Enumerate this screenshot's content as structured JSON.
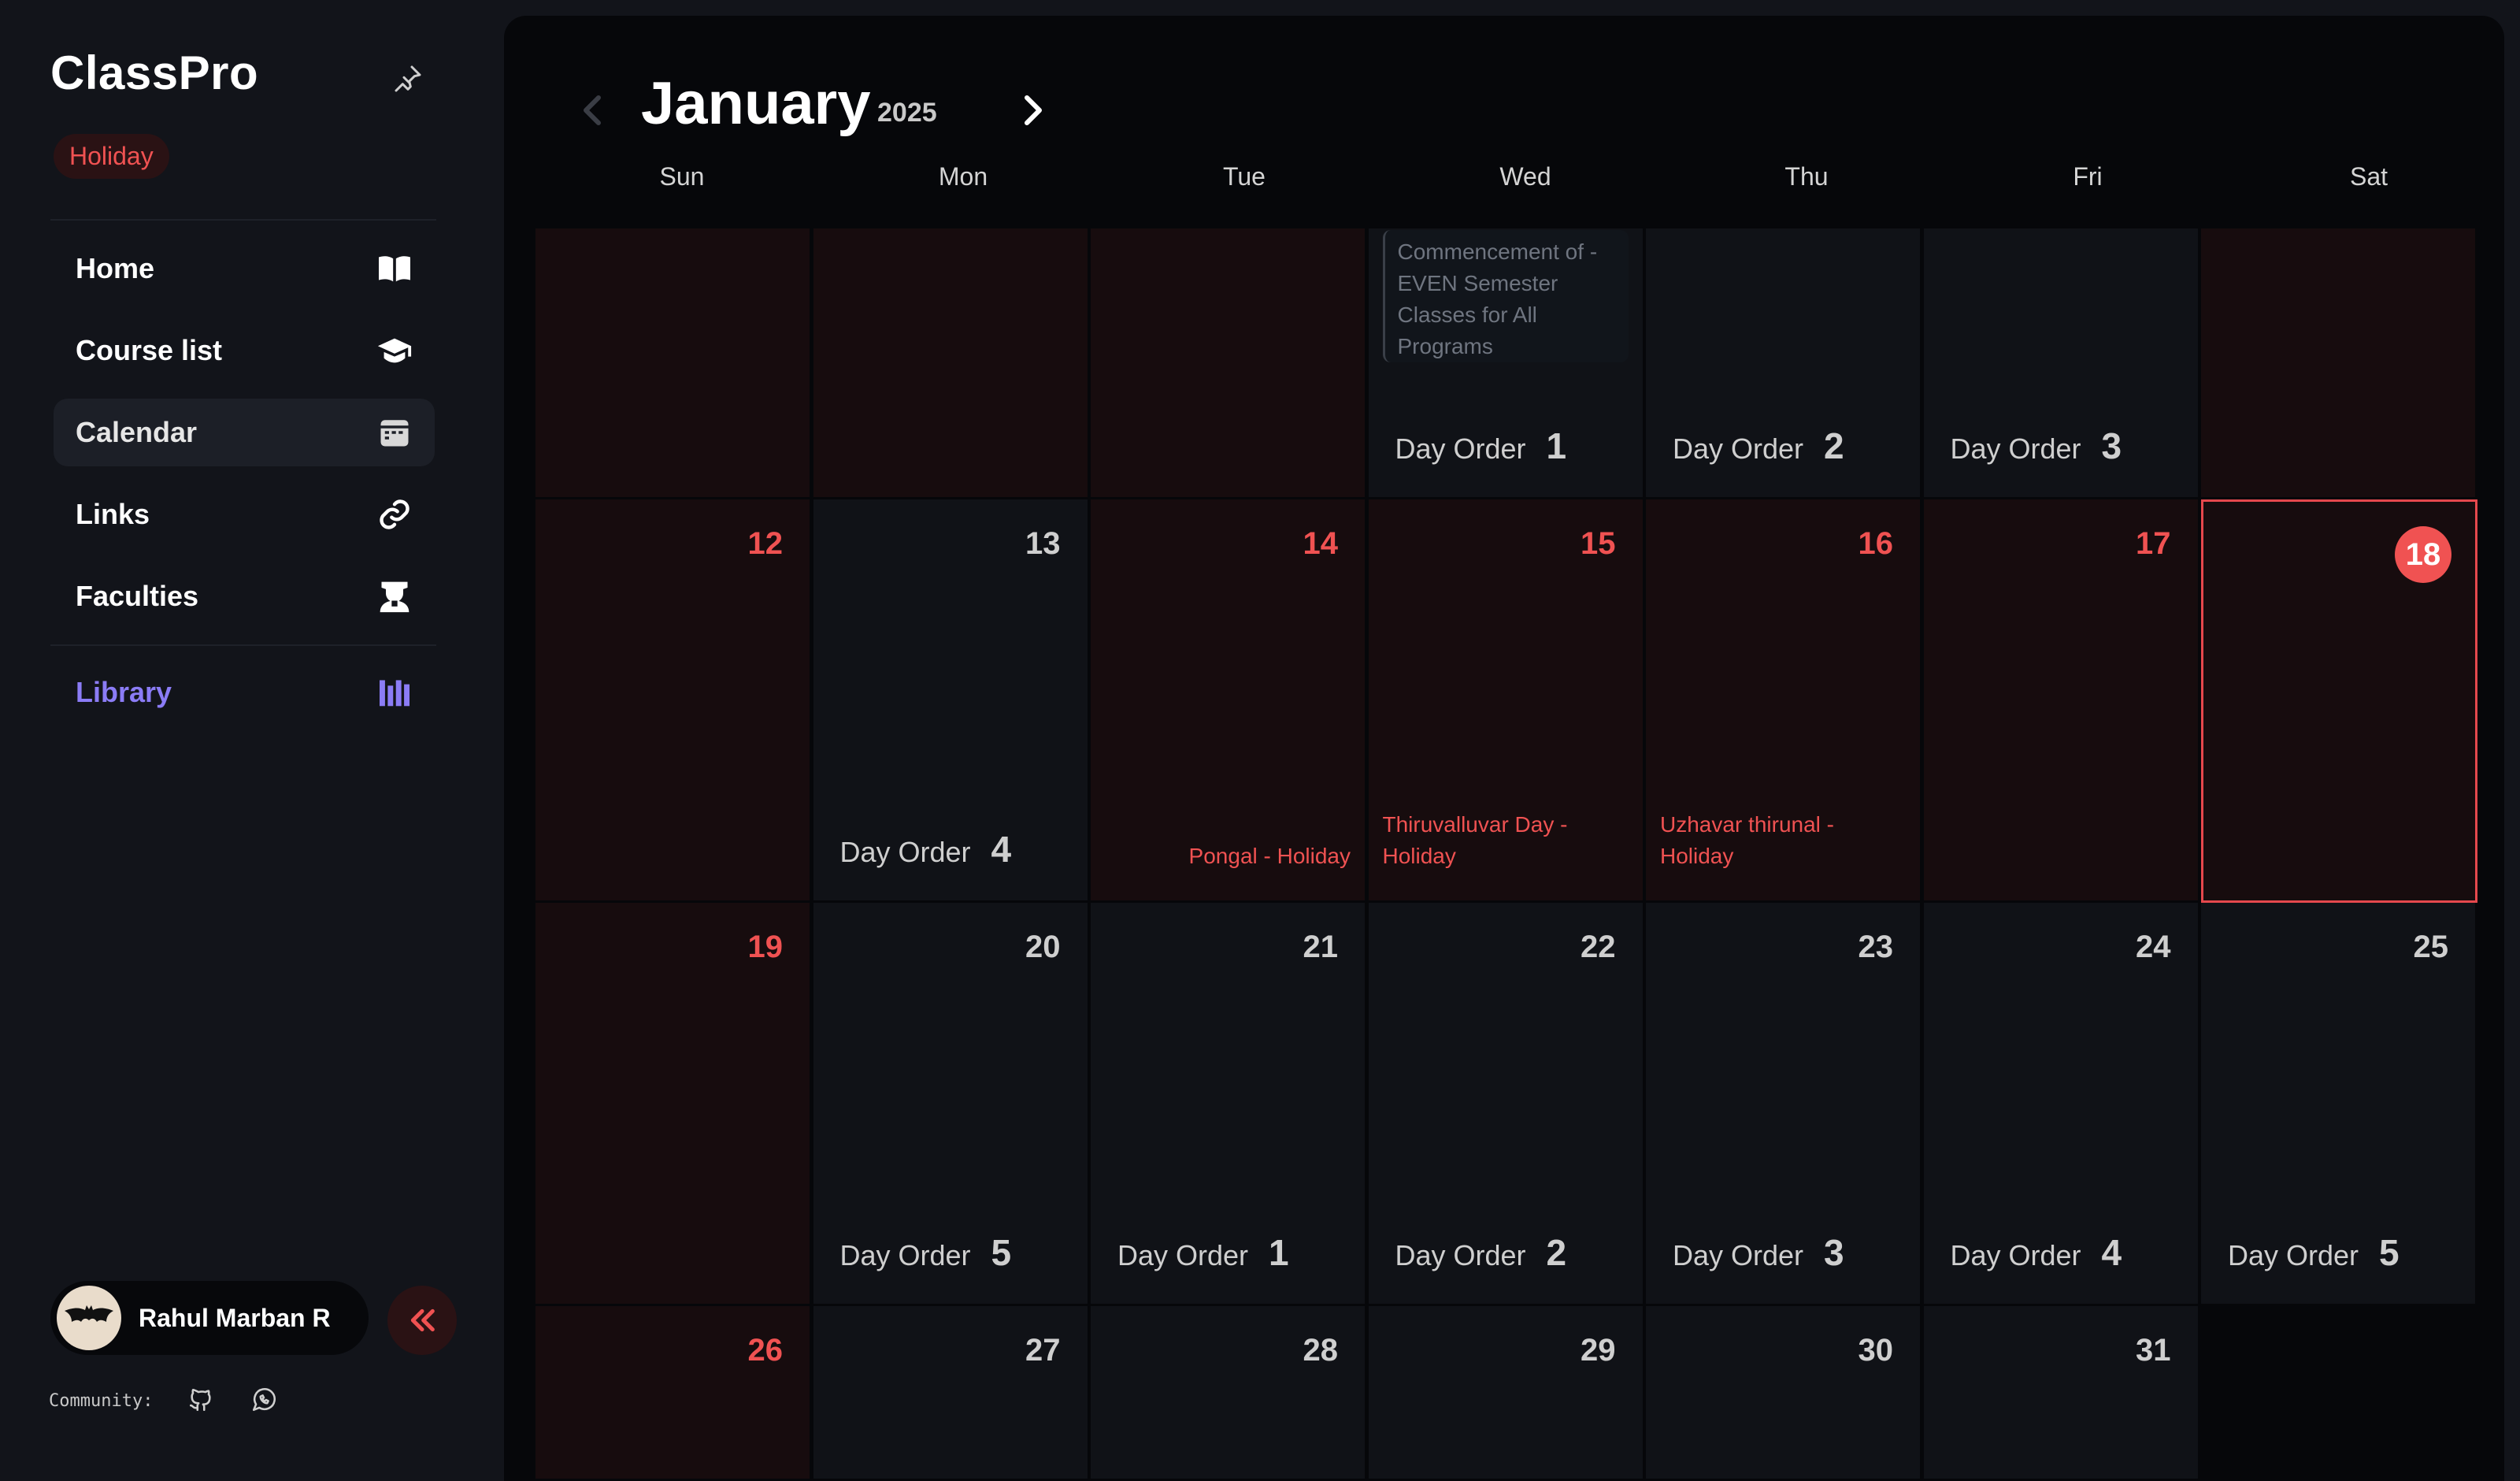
{
  "app": {
    "name": "ClassPro",
    "status_badge": "Holiday"
  },
  "nav": {
    "items": [
      {
        "label": "Home",
        "icon": "book-open-icon"
      },
      {
        "label": "Course list",
        "icon": "graduation-cap-icon"
      },
      {
        "label": "Calendar",
        "icon": "calendar-icon",
        "active": true
      },
      {
        "label": "Links",
        "icon": "link-icon"
      },
      {
        "label": "Faculties",
        "icon": "teacher-icon"
      }
    ],
    "library": {
      "label": "Library",
      "icon": "library-icon"
    }
  },
  "user": {
    "name": "Rahul Marban R",
    "avatar_icon": "bat-avatar-icon"
  },
  "footer": {
    "community_label": "Community:",
    "icons": [
      "github-icon",
      "whatsapp-icon"
    ]
  },
  "calendar": {
    "month": "January",
    "year": "2025",
    "weekdays": [
      "Sun",
      "Mon",
      "Tue",
      "Wed",
      "Thu",
      "Fri",
      "Sat"
    ],
    "day_order_label": "Day Order",
    "rows": [
      [
        {
          "date": "",
          "holiday": true
        },
        {
          "date": "",
          "holiday": true
        },
        {
          "date": "",
          "holiday": true
        },
        {
          "date": "",
          "note": "Commencement of - EVEN Semester Classes for All Programs",
          "order": "1"
        },
        {
          "date": "",
          "order": "2"
        },
        {
          "date": "",
          "order": "3"
        },
        {
          "date": "",
          "holiday": true
        }
      ],
      [
        {
          "date": "12",
          "holiday": true
        },
        {
          "date": "13",
          "order": "4"
        },
        {
          "date": "14",
          "holiday": true,
          "event": "Pongal - Holiday"
        },
        {
          "date": "15",
          "holiday": true,
          "event": "Thiruvalluvar Day - Holiday"
        },
        {
          "date": "16",
          "holiday": true,
          "event": "Uzhavar thirunal - Holiday"
        },
        {
          "date": "17",
          "holiday": true
        },
        {
          "date": "18",
          "holiday": true,
          "today": true
        }
      ],
      [
        {
          "date": "19",
          "holiday": true
        },
        {
          "date": "20",
          "order": "5"
        },
        {
          "date": "21",
          "order": "1"
        },
        {
          "date": "22",
          "order": "2"
        },
        {
          "date": "23",
          "order": "3"
        },
        {
          "date": "24",
          "order": "4"
        },
        {
          "date": "25",
          "order": "5"
        }
      ],
      [
        {
          "date": "26",
          "holiday": true
        },
        {
          "date": "27"
        },
        {
          "date": "28"
        },
        {
          "date": "29"
        },
        {
          "date": "30"
        },
        {
          "date": "31"
        },
        {
          "date": "",
          "blank": true
        }
      ]
    ]
  },
  "colors": {
    "accent_red": "#f05252",
    "accent_purple": "#8b7cf6",
    "panel_bg": "#06070a",
    "sidebar_bg": "#12141a"
  }
}
